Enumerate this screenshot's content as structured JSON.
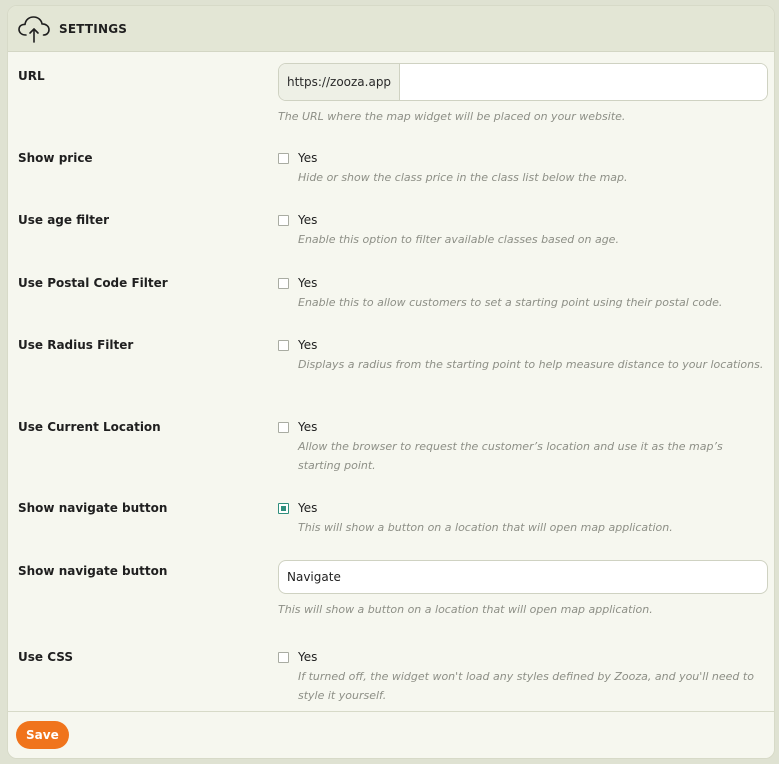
{
  "header": {
    "title": "SETTINGS",
    "icon": "cloud-upload-icon"
  },
  "url": {
    "label": "URL",
    "prefix": "https://zooza.app",
    "value": "",
    "help": "The URL where the map widget will be placed on your website."
  },
  "show_price": {
    "label": "Show price",
    "option": "Yes",
    "checked": false,
    "help": "Hide or show the class price in the class list below the map."
  },
  "age_filter": {
    "label": "Use age filter",
    "option": "Yes",
    "checked": false,
    "help": "Enable this option to filter available classes based on age."
  },
  "postal_filter": {
    "label": "Use Postal Code Filter",
    "option": "Yes",
    "checked": false,
    "help": "Enable this to allow customers to set a starting point using their postal code."
  },
  "radius_filter": {
    "label": "Use Radius Filter",
    "option": "Yes",
    "checked": false,
    "help": "Displays a radius from the starting point to help measure distance to your locations."
  },
  "current_location": {
    "label": "Use Current Location",
    "option": "Yes",
    "checked": false,
    "help": "Allow the browser to request the customer’s location and use it as the map’s starting point."
  },
  "navigate_toggle": {
    "label": "Show navigate button",
    "option": "Yes",
    "checked": true,
    "help": "This will show a button on a location that will open map application."
  },
  "navigate_text": {
    "label": "Show navigate button",
    "value": "Navigate",
    "help": "This will show a button on a location that will open map application."
  },
  "use_css": {
    "label": "Use CSS",
    "option": "Yes",
    "checked": false,
    "help": "If turned off, the widget won't load any styles defined by Zooza, and you'll need to style it yourself."
  },
  "footer": {
    "save_label": "Save"
  },
  "colors": {
    "accent": "#f0741c",
    "check": "#2f8f7d",
    "header_bg": "#e3e6d5",
    "panel_bg": "#f6f7ef"
  }
}
